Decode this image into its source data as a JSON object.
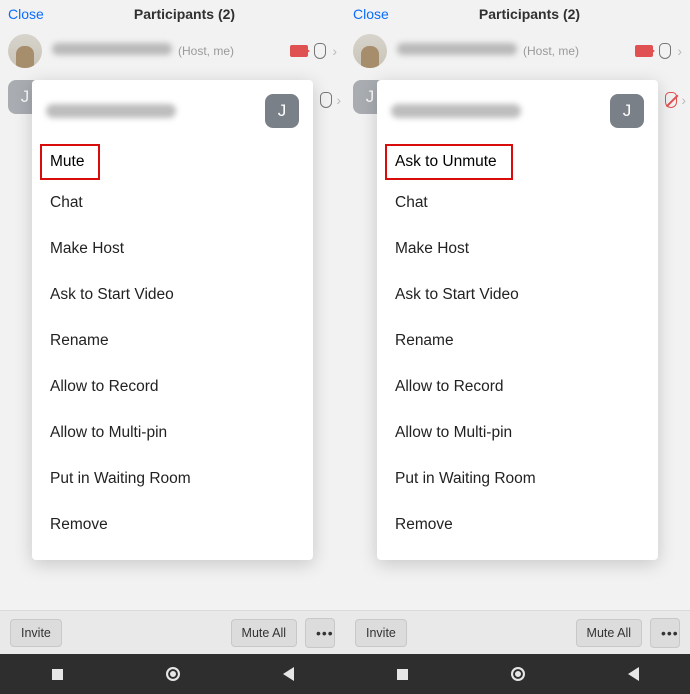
{
  "header": {
    "close": "Close",
    "title": "Participants (2)"
  },
  "host": {
    "meta": "(Host, me)"
  },
  "avatar_letter": "J",
  "menus": {
    "left_primary": "Mute",
    "right_primary": "Ask to Unmute",
    "items": {
      "chat": "Chat",
      "make_host": "Make Host",
      "start_video": "Ask to Start Video",
      "rename": "Rename",
      "record": "Allow to Record",
      "multipin": "Allow to Multi-pin",
      "waiting": "Put in Waiting Room",
      "remove": "Remove"
    }
  },
  "footer": {
    "invite": "Invite",
    "mute_all": "Mute All",
    "more": "•••"
  }
}
